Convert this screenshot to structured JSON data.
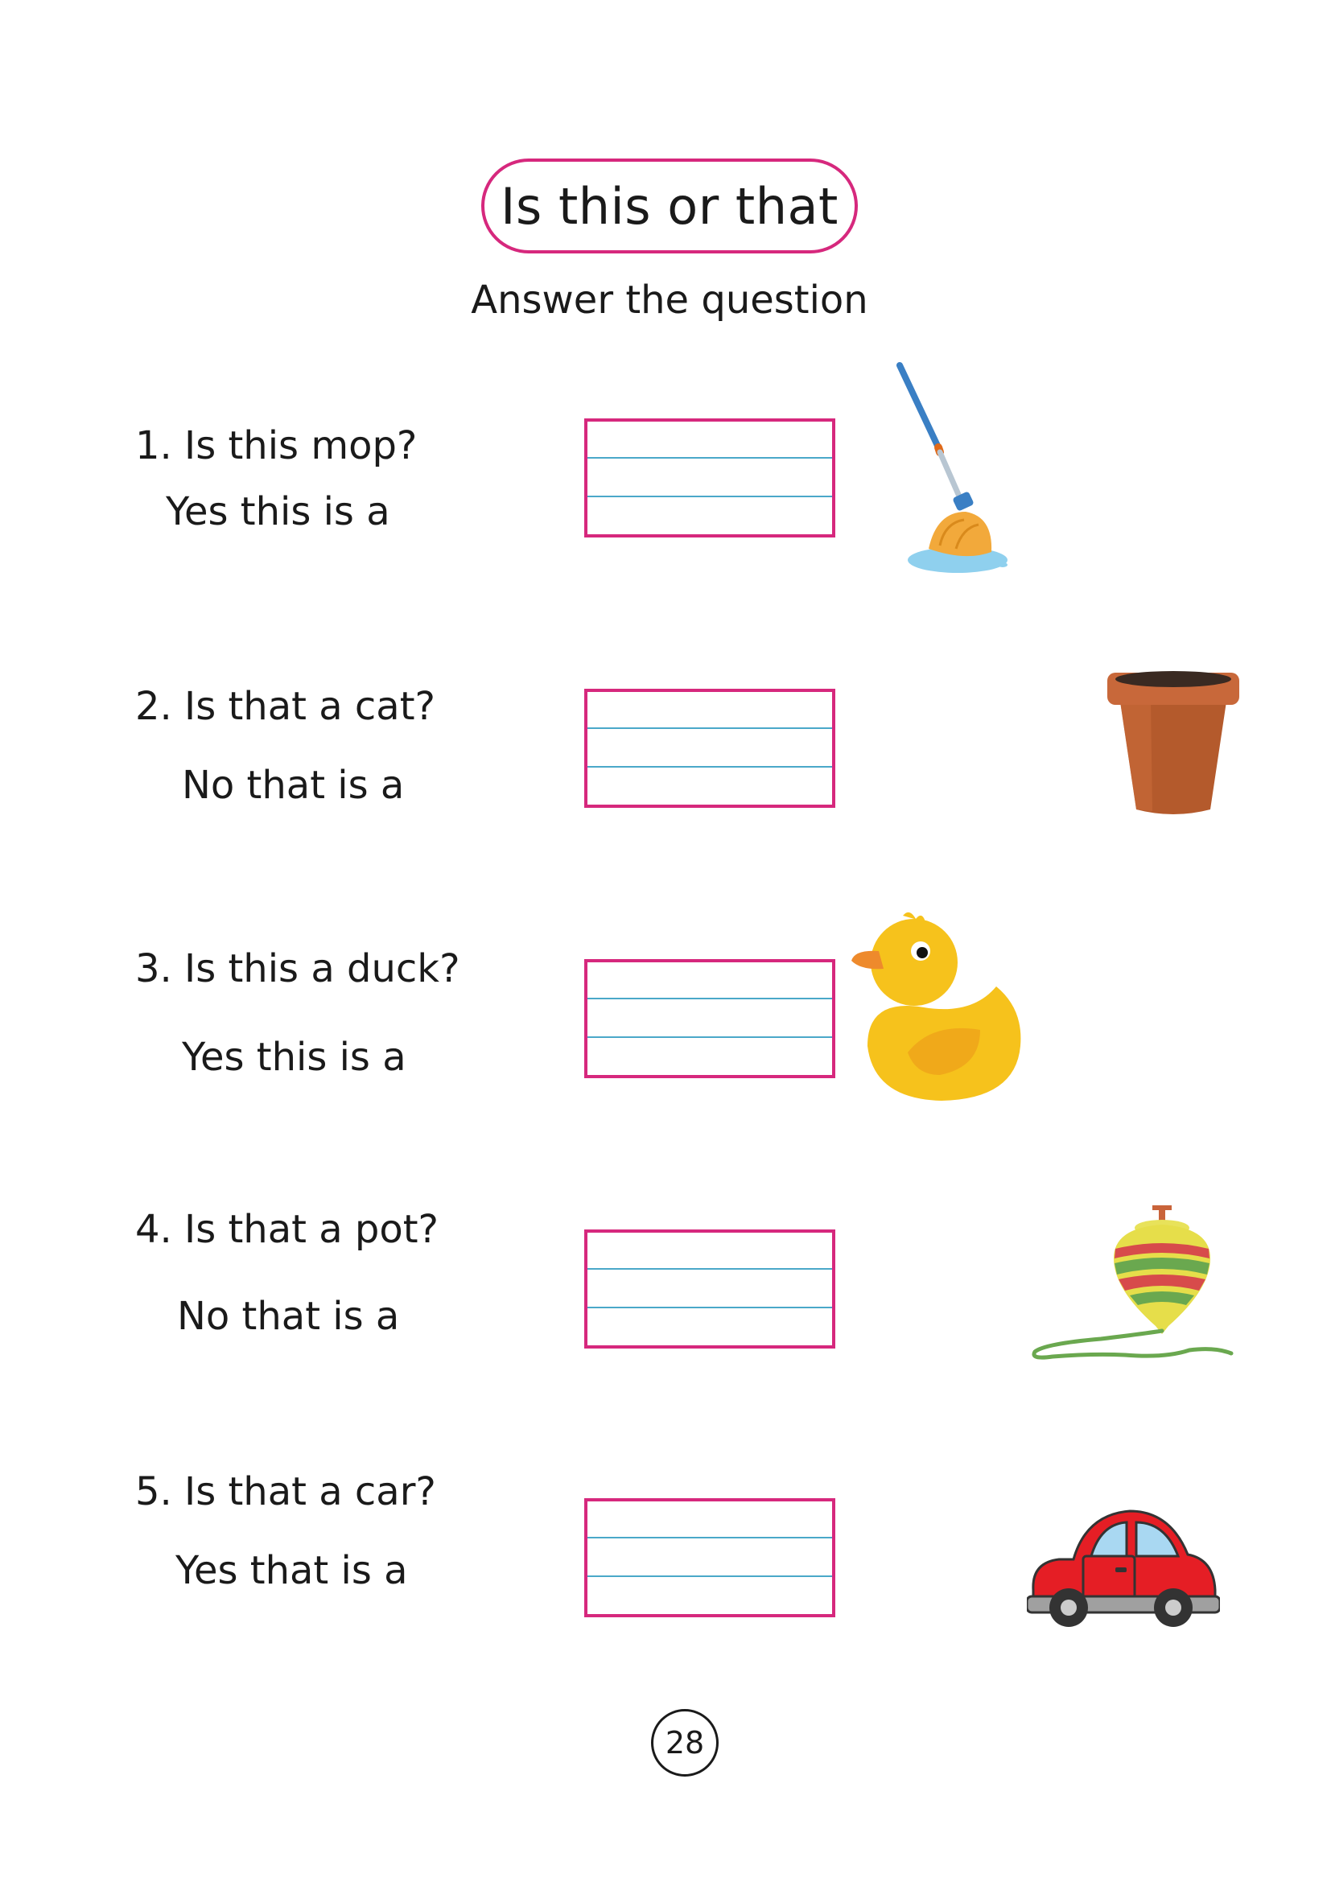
{
  "title": "Is this or that",
  "subtitle": "Answer the question",
  "items": [
    {
      "question": "1. Is this mop?",
      "answer": "Yes this is a",
      "picture": "mop-icon"
    },
    {
      "question": "2. Is that a cat?",
      "answer": "No that is a",
      "picture": "flower-pot-icon"
    },
    {
      "question": "3. Is this a duck?",
      "answer": "Yes this is a",
      "picture": "rubber-duck-icon"
    },
    {
      "question": "4. Is that a pot?",
      "answer": "No that is a",
      "picture": "spinning-top-icon"
    },
    {
      "question": "5. Is that a car?",
      "answer": "Yes that is a",
      "picture": "toy-car-icon"
    }
  ],
  "page_number": "28",
  "colors": {
    "accent": "#d6287d",
    "ruling": "#4aa8c9"
  }
}
